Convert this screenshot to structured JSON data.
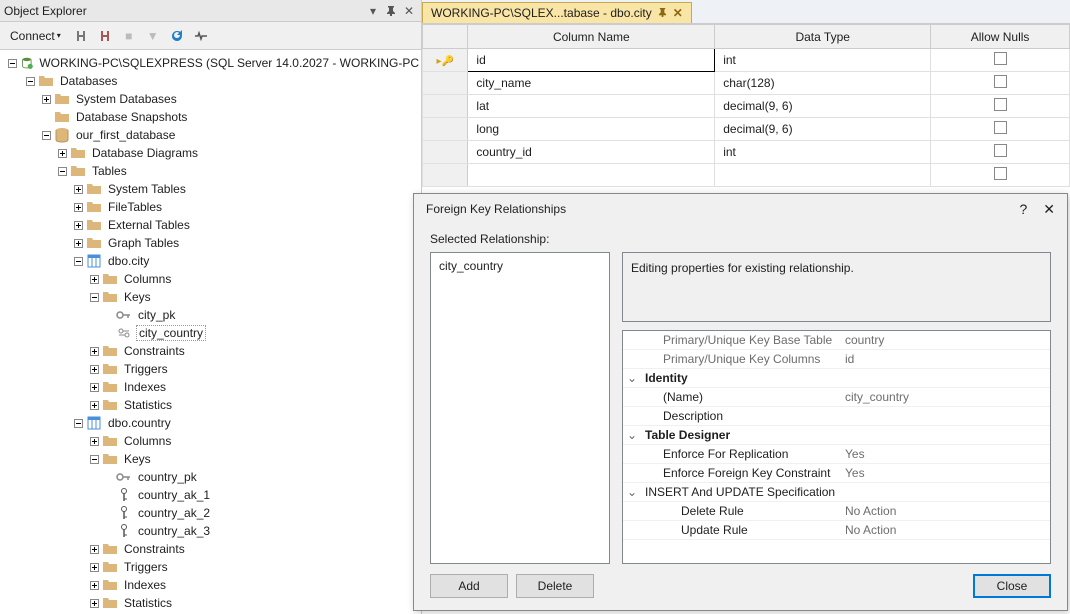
{
  "objectExplorer": {
    "title": "Object Explorer",
    "connectLabel": "Connect",
    "server": "WORKING-PC\\SQLEXPRESS (SQL Server 14.0.2027 - WORKING-PC",
    "nodes": {
      "databases": "Databases",
      "systemDatabases": "System Databases",
      "databaseSnapshots": "Database Snapshots",
      "ourFirstDatabase": "our_first_database",
      "databaseDiagrams": "Database Diagrams",
      "tables": "Tables",
      "systemTables": "System Tables",
      "fileTables": "FileTables",
      "externalTables": "External Tables",
      "graphTables": "Graph Tables",
      "dboCity": "dbo.city",
      "columns": "Columns",
      "keys": "Keys",
      "cityPk": "city_pk",
      "cityCountry": "city_country",
      "constraints": "Constraints",
      "triggers": "Triggers",
      "indexes": "Indexes",
      "statistics": "Statistics",
      "dboCountry": "dbo.country",
      "countryPk": "country_pk",
      "countryAk1": "country_ak_1",
      "countryAk2": "country_ak_2",
      "countryAk3": "country_ak_3"
    }
  },
  "tab": {
    "label": "WORKING-PC\\SQLEX...tabase - dbo.city"
  },
  "grid": {
    "headers": {
      "name": "Column Name",
      "type": "Data Type",
      "nulls": "Allow Nulls"
    },
    "rows": [
      {
        "name": "id",
        "type": "int",
        "nulls": false,
        "pk": true
      },
      {
        "name": "city_name",
        "type": "char(128)",
        "nulls": false
      },
      {
        "name": "lat",
        "type": "decimal(9, 6)",
        "nulls": false
      },
      {
        "name": "long",
        "type": "decimal(9, 6)",
        "nulls": false
      },
      {
        "name": "country_id",
        "type": "int",
        "nulls": false
      }
    ]
  },
  "dialog": {
    "title": "Foreign Key Relationships",
    "selectedRelLabel": "Selected Relationship:",
    "relationships": [
      "city_country"
    ],
    "description": "Editing properties for existing relationship.",
    "props": {
      "pkBaseTableLabel": "Primary/Unique Key Base Table",
      "pkBaseTableValue": "country",
      "pkColumnsLabel": "Primary/Unique Key Columns",
      "pkColumnsValue": "id",
      "identityLabel": "Identity",
      "nameLabel": "(Name)",
      "nameValue": "city_country",
      "descriptionLabel": "Description",
      "descriptionValue": "",
      "tableDesignerLabel": "Table Designer",
      "enforceReplLabel": "Enforce For Replication",
      "enforceReplValue": "Yes",
      "enforceFkLabel": "Enforce Foreign Key Constraint",
      "enforceFkValue": "Yes",
      "insertUpdateLabel": "INSERT And UPDATE Specification",
      "deleteRuleLabel": "Delete Rule",
      "deleteRuleValue": "No Action",
      "updateRuleLabel": "Update Rule",
      "updateRuleValue": "No Action"
    },
    "buttons": {
      "add": "Add",
      "delete": "Delete",
      "close": "Close"
    }
  }
}
